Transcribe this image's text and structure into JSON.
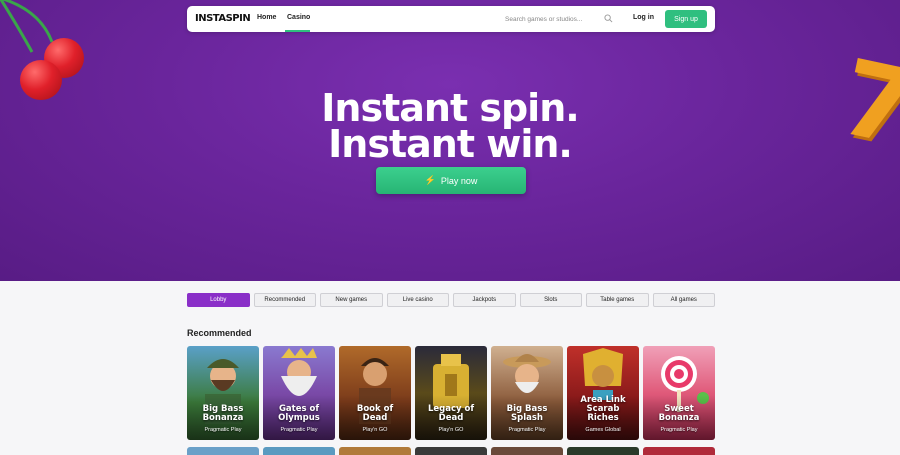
{
  "nav": {
    "logo": "INSTASPIN",
    "links": [
      {
        "label": "Home"
      },
      {
        "label": "Casino"
      }
    ],
    "search_placeholder": "Search games or studios...",
    "login_label": "Log in",
    "signup_label": "Sign up"
  },
  "hero": {
    "line1": "Instant spin.",
    "line2": "Instant win.",
    "play_label": "Play now"
  },
  "filters": [
    {
      "label": "Lobby",
      "active": true
    },
    {
      "label": "Recommended",
      "active": false
    },
    {
      "label": "New games",
      "active": false
    },
    {
      "label": "Live casino",
      "active": false
    },
    {
      "label": "Jackpots",
      "active": false
    },
    {
      "label": "Slots",
      "active": false
    },
    {
      "label": "Table games",
      "active": false
    },
    {
      "label": "All games",
      "active": false
    }
  ],
  "section_title": "Recommended",
  "games": [
    {
      "title_1": "Big Bass",
      "title_2": "Bonanza",
      "title_3": "",
      "studio": "Pragmatic Play"
    },
    {
      "title_1": "Gates of",
      "title_2": "Olympus",
      "title_3": "",
      "studio": "Pragmatic Play"
    },
    {
      "title_1": "Book of",
      "title_2": "Dead",
      "title_3": "",
      "studio": "Play'n GO"
    },
    {
      "title_1": "Legacy of",
      "title_2": "Dead",
      "title_3": "",
      "studio": "Play'n GO"
    },
    {
      "title_1": "Big Bass",
      "title_2": "Splash",
      "title_3": "",
      "studio": "Pragmatic Play"
    },
    {
      "title_1": "Area Link",
      "title_2": "Scarab",
      "title_3": "Riches",
      "studio": "Games Global"
    },
    {
      "title_1": "Sweet",
      "title_2": "Bonanza",
      "title_3": "",
      "studio": "Pragmatic Play"
    }
  ],
  "colors": {
    "hero_purple": "#6a259c",
    "accent_green": "#2fbf7f",
    "filter_active": "#8a2fc8"
  }
}
